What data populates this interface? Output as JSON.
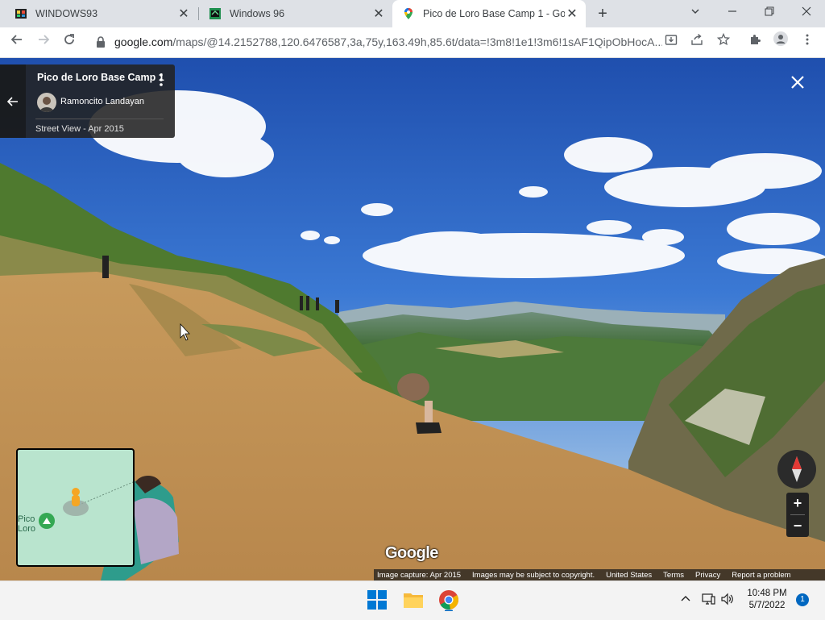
{
  "browser": {
    "tabs": [
      {
        "title": "WINDOWS93",
        "icon": "windows93-favicon"
      },
      {
        "title": "Windows 96",
        "icon": "windows96-favicon"
      },
      {
        "title": "Pico de Loro Base Camp 1 - Goo",
        "icon": "google-maps-favicon",
        "active": true
      }
    ],
    "new_tab": "+",
    "url_host": "google.com",
    "url_path": "/maps/@14.2152788,120.6476587,3a,75y,163.49h,85.6t/data=!3m8!1e1!3m6!1sAF1QipObHocA..."
  },
  "streetview": {
    "place_name": "Pico de Loro Base Camp 1",
    "author": "Ramoncito Landayan",
    "date_label": "Street View - Apr 2015",
    "minimap_label_line1": "Pico",
    "minimap_label_line2": "Loro",
    "zoom_in": "+",
    "zoom_out": "−",
    "logo": "Google",
    "footer": {
      "capture": "Image capture: Apr 2015",
      "copyright": "Images may be subject to copyright.",
      "region": "United States",
      "terms": "Terms",
      "privacy": "Privacy",
      "report": "Report a problem"
    }
  },
  "taskbar": {
    "time": "10:48 PM",
    "date": "5/7/2022",
    "notifications": "1"
  },
  "colors": {
    "accent": "#1a73e8",
    "sky_top": "#2456b8",
    "ground": "#c9a46a"
  }
}
